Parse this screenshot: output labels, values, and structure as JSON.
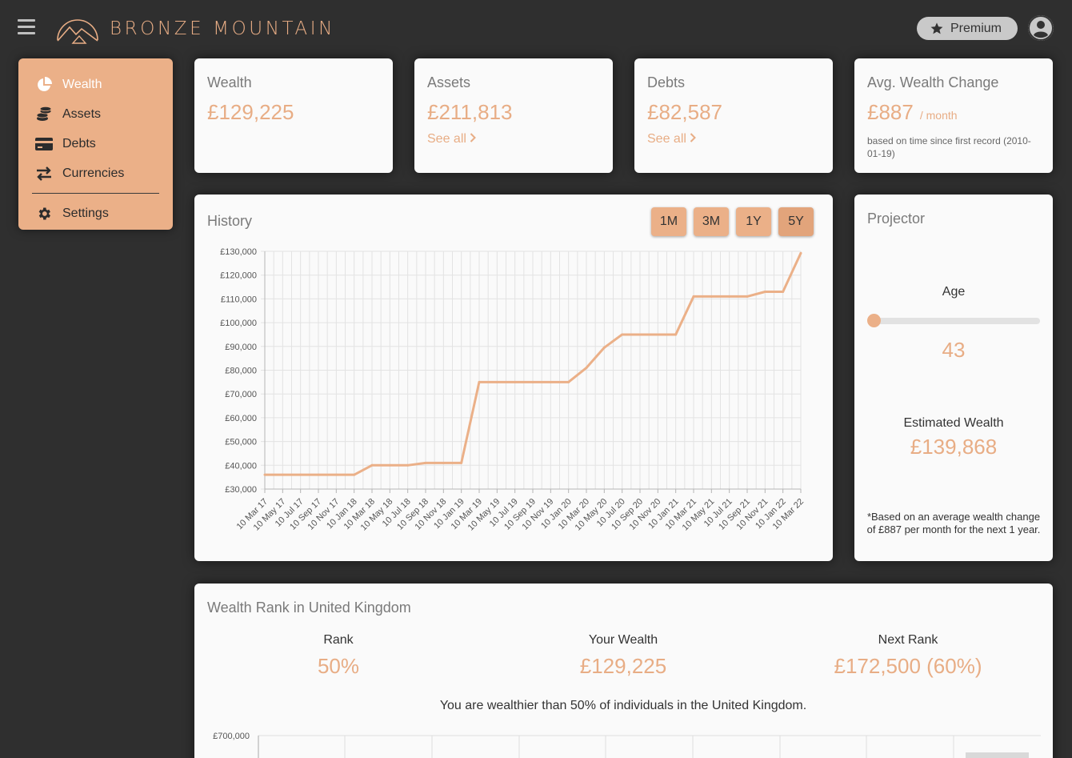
{
  "header": {
    "brand": "BRONZE MOUNTAIN",
    "premium_label": "Premium"
  },
  "sidebar": {
    "items": [
      {
        "label": "Wealth",
        "icon": "pie-chart-icon",
        "active": true
      },
      {
        "label": "Assets",
        "icon": "coins-icon"
      },
      {
        "label": "Debts",
        "icon": "credit-card-icon"
      },
      {
        "label": "Currencies",
        "icon": "exchange-icon"
      }
    ],
    "settings_label": "Settings"
  },
  "summary": {
    "wealth": {
      "title": "Wealth",
      "value": "£129,225"
    },
    "assets": {
      "title": "Assets",
      "value": "£211,813",
      "link": "See all"
    },
    "debts": {
      "title": "Debts",
      "value": "£82,587",
      "link": "See all"
    },
    "avg_change": {
      "title": "Avg. Wealth Change",
      "value": "£887",
      "unit": "/ month",
      "note": "based on time since first record (2010-01-19)"
    }
  },
  "history": {
    "title": "History",
    "ranges": [
      "1M",
      "3M",
      "1Y",
      "5Y"
    ],
    "active_range": "5Y"
  },
  "chart_data": {
    "type": "line",
    "title": "",
    "xlabel": "",
    "ylabel": "",
    "ylim": [
      30000,
      130000
    ],
    "y_ticks": [
      "£30,000",
      "£40,000",
      "£50,000",
      "£60,000",
      "£70,000",
      "£80,000",
      "£90,000",
      "£100,000",
      "£110,000",
      "£120,000",
      "£130,000"
    ],
    "x": [
      "10 Mar 17",
      "10 May 17",
      "10 Jul 17",
      "10 Sep 17",
      "10 Nov 17",
      "10 Jan 18",
      "10 Mar 18",
      "10 May 18",
      "10 Jul 18",
      "10 Sep 18",
      "10 Nov 18",
      "10 Jan 19",
      "10 Mar 19",
      "10 May 19",
      "10 Jul 19",
      "10 Sep 19",
      "10 Nov 19",
      "10 Jan 20",
      "10 Mar 20",
      "10 May 20",
      "10 Jul 20",
      "10 Sep 20",
      "10 Nov 20",
      "10 Jan 21",
      "10 Mar 21",
      "10 May 21",
      "10 Jul 21",
      "10 Sep 21",
      "10 Nov 21",
      "10 Jan 22",
      "10 Mar 22"
    ],
    "grid": true,
    "series": [
      {
        "values": [
          36000,
          36000,
          36000,
          36000,
          36000,
          36000,
          40000,
          40000,
          40000,
          41000,
          41000,
          41000,
          75000,
          75000,
          75000,
          75000,
          75000,
          75000,
          81000,
          89500,
          95000,
          95000,
          95000,
          95000,
          111000,
          111000,
          111000,
          111000,
          113000,
          113000,
          129225
        ]
      }
    ],
    "color": "#ebb088"
  },
  "projector": {
    "title": "Projector",
    "age_label": "Age",
    "age_value": "43",
    "age_slider_fraction": 0.0,
    "estimate_label": "Estimated Wealth",
    "estimate_value": "£139,868",
    "footnote": "*Based on an average wealth change of £887 per month for the next 1 year."
  },
  "rank": {
    "title": "Wealth Rank in United Kingdom",
    "rank_label": "Rank",
    "rank_value": "50%",
    "your_label": "Your Wealth",
    "your_value": "£129,225",
    "next_label": "Next Rank",
    "next_value": "£172,500 (60%)",
    "sentence": "You are wealthier than 50% of individuals in the United Kingdom.",
    "chart_top_tick": "£700,000"
  }
}
